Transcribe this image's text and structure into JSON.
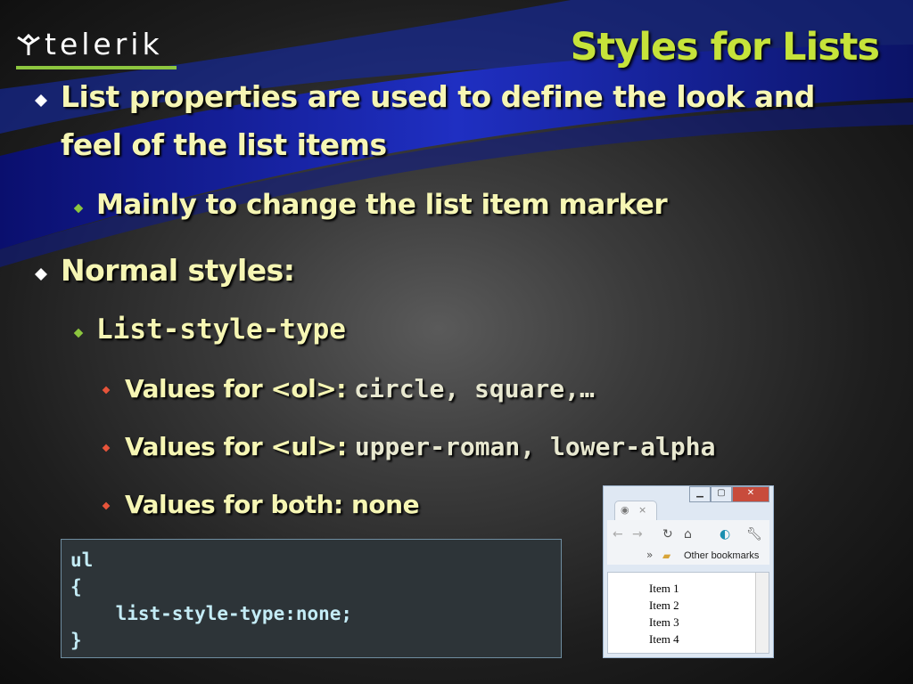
{
  "logo": {
    "text": "telerik"
  },
  "title": "Styles for Lists",
  "bullets": {
    "b1_line1": "List properties are used to define the look and",
    "b1_line2": "feel of the list items",
    "b1_sub": "Mainly to change the list item marker",
    "b2": "Normal styles:",
    "b2_sub": "List-style-type",
    "v1_prefix": "Values for <ol>: ",
    "v1_code": "circle, square,…",
    "v2_prefix": "Values for <ul>: ",
    "v2_code": "upper-roman, lower-alpha",
    "v3_prefix": "Values for both: ",
    "v3_value": "none"
  },
  "code": {
    "line1": "ul",
    "line2": "{",
    "line3": "    list-style-type:none;",
    "line4": "}"
  },
  "browser": {
    "bookmarks_label": "Other bookmarks",
    "chevron": "»",
    "items": [
      "Item 1",
      "Item 2",
      "Item 3",
      "Item 4"
    ]
  },
  "colors": {
    "title": "#c6e33a",
    "bullet_text": "#f6f6b4",
    "level1_marker": "#ffffff",
    "level2_marker": "#8dc63f",
    "level3_marker": "#e7543a",
    "code_text": "#c4ecf6"
  }
}
